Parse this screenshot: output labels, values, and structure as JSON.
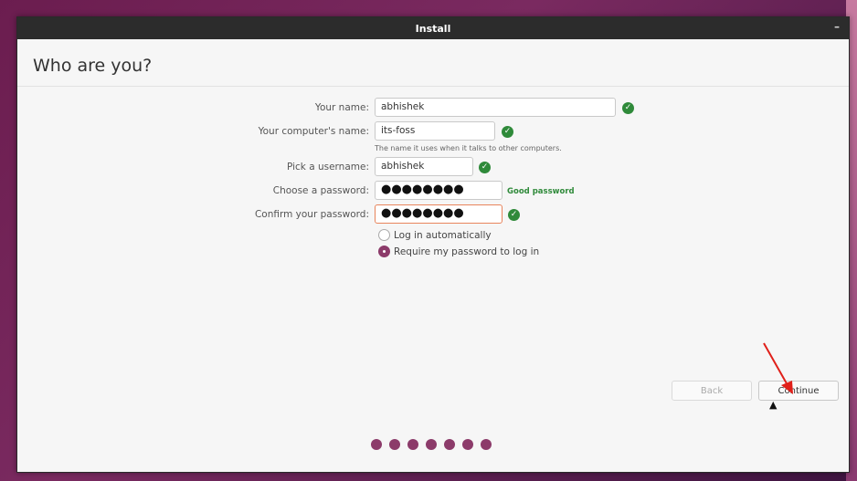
{
  "window": {
    "title": "Install",
    "minimize_glyph": "–"
  },
  "page": {
    "title": "Who are you?"
  },
  "form": {
    "name_label": "Your name:",
    "name_value": "abhishek",
    "computer_label": "Your computer's name:",
    "computer_value": "its-foss",
    "computer_hint": "The name it uses when it talks to other computers.",
    "username_label": "Pick a username:",
    "username_value": "abhishek",
    "password_label": "Choose a password:",
    "password_value": "●●●●●●●●",
    "password_strength": "Good password",
    "confirm_label": "Confirm your password:",
    "confirm_value": "●●●●●●●●",
    "check_glyph": "✓"
  },
  "login_options": {
    "auto_label": "Log in automatically",
    "require_label": "Require my password to log in",
    "selected": "require"
  },
  "buttons": {
    "back": "Back",
    "continue": "Continue"
  },
  "progress": {
    "steps": 7
  },
  "colors": {
    "accent": "#8c3b6a",
    "success": "#2f8a3a",
    "annotation_arrow": "#e0201a"
  },
  "icons": {
    "check": "check-circle-icon",
    "arrow": "red-arrow-annotation",
    "cursor": "mouse-pointer-icon"
  }
}
